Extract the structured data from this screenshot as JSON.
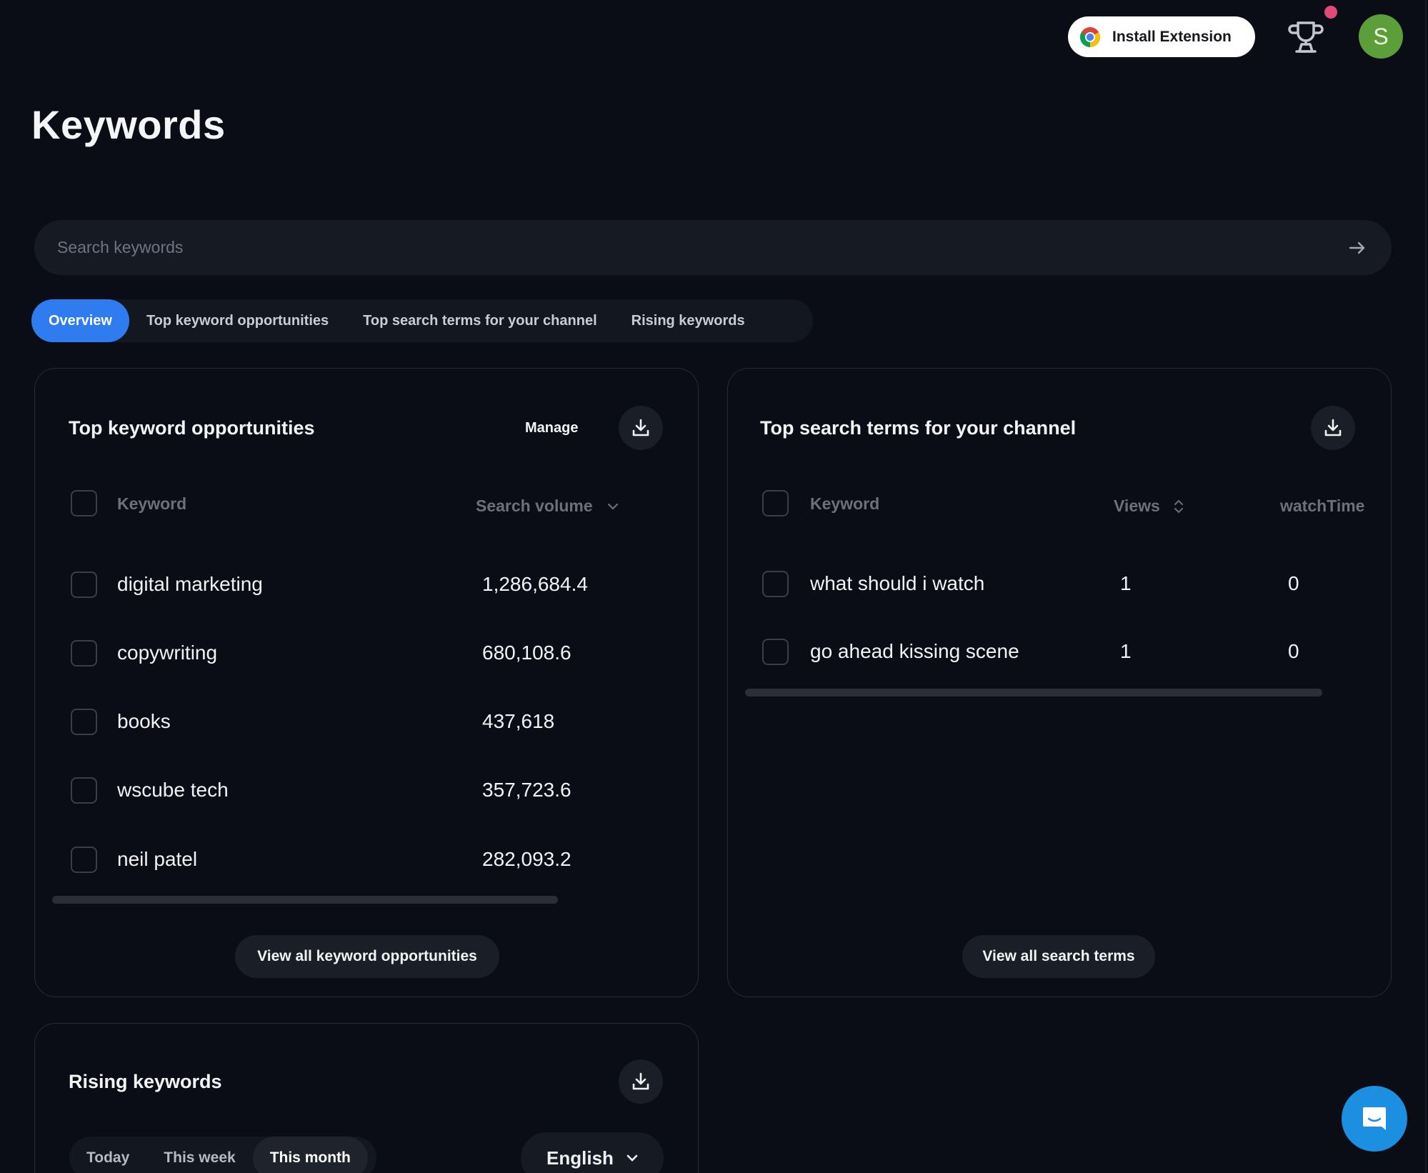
{
  "header": {
    "install_extension_label": "Install Extension",
    "avatar_initial": "S",
    "notification_dot_color": "#e24a78",
    "avatar_color": "#5c9e3a"
  },
  "page": {
    "title": "Keywords"
  },
  "search": {
    "placeholder": "Search keywords",
    "value": ""
  },
  "tabs": [
    {
      "label": "Overview",
      "active": true
    },
    {
      "label": "Top keyword opportunities",
      "active": false
    },
    {
      "label": "Top search terms for your channel",
      "active": false
    },
    {
      "label": "Rising keywords",
      "active": false
    }
  ],
  "accent_color": "#2f7bf0",
  "top_keyword_opportunities": {
    "title": "Top keyword opportunities",
    "manage_label": "Manage",
    "columns": {
      "keyword": "Keyword",
      "search_volume": "Search volume"
    },
    "rows": [
      {
        "keyword": "digital marketing",
        "search_volume": "1,286,684.4"
      },
      {
        "keyword": "copywriting",
        "search_volume": "680,108.6"
      },
      {
        "keyword": "books",
        "search_volume": "437,618"
      },
      {
        "keyword": "wscube tech",
        "search_volume": "357,723.6"
      },
      {
        "keyword": "neil patel",
        "search_volume": "282,093.2"
      }
    ],
    "view_all_label": "View all keyword opportunities"
  },
  "top_search_terms": {
    "title": "Top search terms for your channel",
    "columns": {
      "keyword": "Keyword",
      "views": "Views",
      "watch_time": "watchTime"
    },
    "rows": [
      {
        "keyword": "what should i watch",
        "views": "1",
        "watch_time": "0"
      },
      {
        "keyword": "go ahead kissing scene",
        "views": "1",
        "watch_time": "0"
      }
    ],
    "view_all_label": "View all search terms"
  },
  "rising_keywords": {
    "title": "Rising keywords",
    "periods": [
      {
        "label": "Today",
        "active": false
      },
      {
        "label": "This week",
        "active": false
      },
      {
        "label": "This month",
        "active": true
      }
    ],
    "language": "English"
  }
}
